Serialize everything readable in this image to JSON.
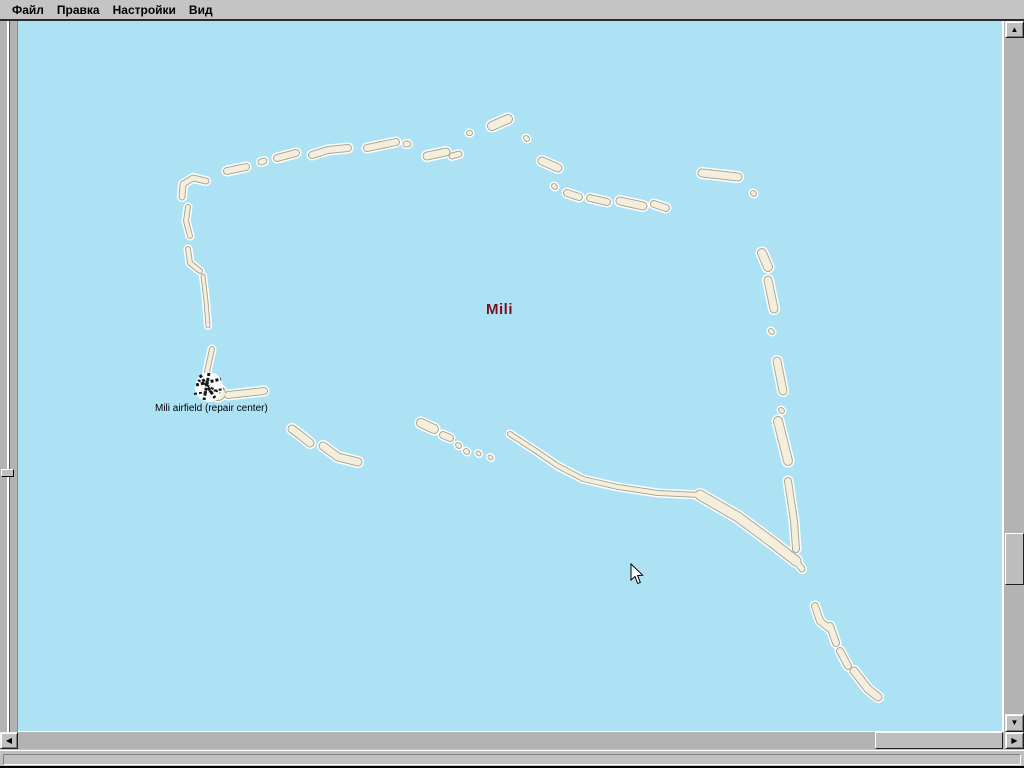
{
  "menu": {
    "items": [
      {
        "label": "Файл"
      },
      {
        "label": "Правка"
      },
      {
        "label": "Настройки"
      },
      {
        "label": "Вид"
      }
    ]
  },
  "map": {
    "region_label": "Mili",
    "airfield_label": "Mili airfield (repair center)",
    "colors": {
      "water": "#ADE2F5",
      "island_fill": "#F4EFDD",
      "island_outline": "#A9A694",
      "island_halo": "#FFFFFF",
      "region_label_color": "#7B1120",
      "airfield_label_color": "#000000"
    }
  },
  "scrollbars": {
    "vertical": {
      "up_icon": "▲",
      "down_icon": "▼"
    },
    "horizontal": {
      "left_icon": "◀",
      "right_icon": "▶"
    }
  },
  "slider": {
    "orientation": "vertical"
  },
  "status_bar": {
    "text": ""
  }
}
